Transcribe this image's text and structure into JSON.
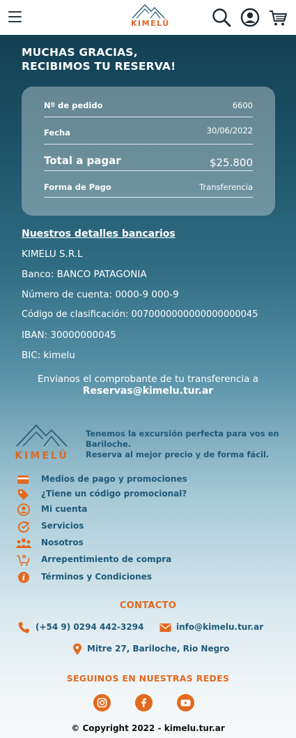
{
  "header": {
    "logo_text": "KIMELÜ",
    "menu_icon": "hamburger-icon",
    "search_icon": "search-icon",
    "account_icon": "user-circle-icon",
    "cart_icon": "cart-icon"
  },
  "hero": {
    "line1": "MUCHAS GRACIAS,",
    "line2": "RECIBIMOS TU RESERVA!"
  },
  "order": {
    "rows": [
      {
        "label": "Nº de pedido",
        "value": "6600"
      },
      {
        "label": "Fecha",
        "value": "30/06/2022"
      },
      {
        "label": "Total a pagar",
        "value": "$25.800"
      },
      {
        "label": "Forma de Pago",
        "value": "Transferencia"
      }
    ]
  },
  "bank": {
    "title": "Nuestros detalles bancarios",
    "lines": [
      "KIMELU S.R.L",
      "Banco: BANCO PATAGONIA",
      "Número de cuenta: 0000-9 000-9",
      "Código de clasificación: 0070000000000000000045",
      "IBAN: 30000000045",
      "BIC: kimelu"
    ],
    "note": "Envianos el comprobante de tu transferencia a",
    "email": "Reservas@kimelu.tur.ar"
  },
  "footer": {
    "logo_text": "KIMELÜ",
    "tagline1": "Tenemos la excursión perfecta para vos en Bariloche.",
    "tagline2": "Reserva al mejor precio y de forma fácil.",
    "links": [
      {
        "label": "Medios de pago y promociones",
        "icon": "credit-card-icon"
      },
      {
        "label": "¿Tiene un código promocional?",
        "icon": "tag-icon"
      },
      {
        "label": "Mi cuenta",
        "icon": "user-icon"
      },
      {
        "label": "Servicios",
        "icon": "services-icon"
      },
      {
        "label": "Nosotros",
        "icon": "group-icon"
      },
      {
        "label": "Arrepentimiento de compra",
        "icon": "cart-cancel-icon"
      },
      {
        "label": "Términos y Condiciones",
        "icon": "info-icon"
      }
    ],
    "contact_title": "CONTACTO",
    "phone": "(+54 9) 0294 442-3294",
    "email": "info@kimelu.tur.ar",
    "address": "Mitre 27, Bariloche, Rio Negro",
    "social_title": "SEGUINOS EN NUESTRAS REDES",
    "social": [
      "instagram-icon",
      "facebook-icon",
      "youtube-icon"
    ],
    "copyright": "© Copyright 2022 - kimelu.tur.ar"
  },
  "colors": {
    "accent": "#e2691f",
    "link": "#1f5a78",
    "dark": "#0f3a4c"
  }
}
